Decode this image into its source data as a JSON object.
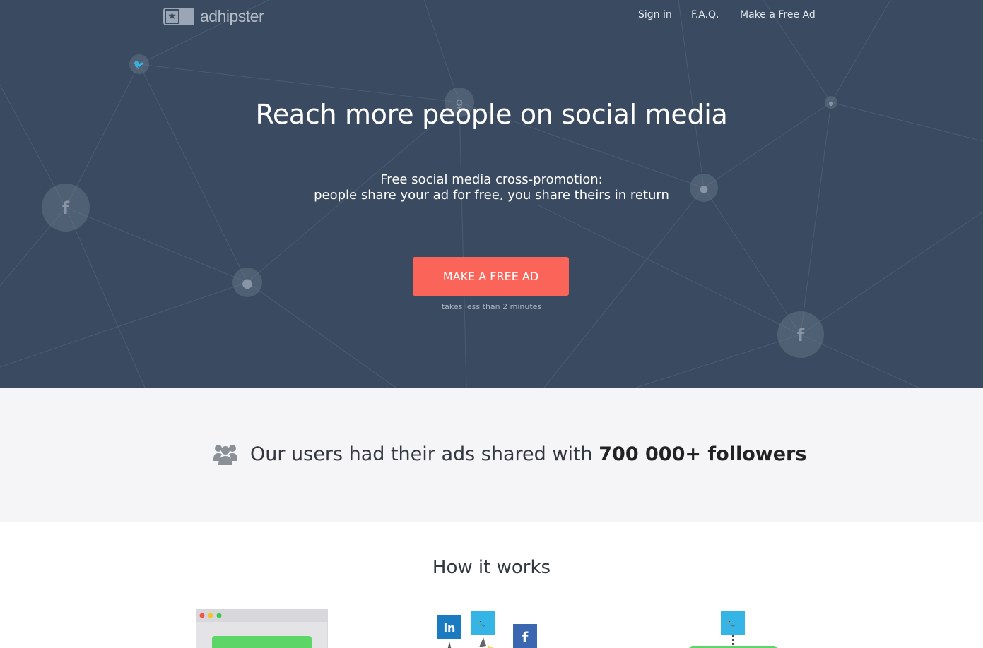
{
  "brand": {
    "name": "adhipster"
  },
  "nav": {
    "signin": "Sign in",
    "faq": "F.A.Q.",
    "make_ad": "Make a Free Ad"
  },
  "hero": {
    "title": "Reach more people on social media",
    "subtitle_line1": "Free social media cross-promotion:",
    "subtitle_line2": "people share your ad for free, you share theirs in return",
    "cta": "MAKE A FREE AD",
    "cta_note": "takes less than 2 minutes"
  },
  "stats": {
    "text_prefix": "Our users had their ads shared with",
    "highlight": "700 000+ followers"
  },
  "how": {
    "title": "How it works"
  },
  "colors": {
    "hero_bg": "#3a4a60",
    "accent": "#fb6458",
    "stats_bg": "#f5f5f7"
  },
  "icons": [
    "logo-star-icon",
    "twitter-icon",
    "facebook-icon",
    "user-icon",
    "google-icon",
    "users-group-icon",
    "linkedin-icon"
  ]
}
